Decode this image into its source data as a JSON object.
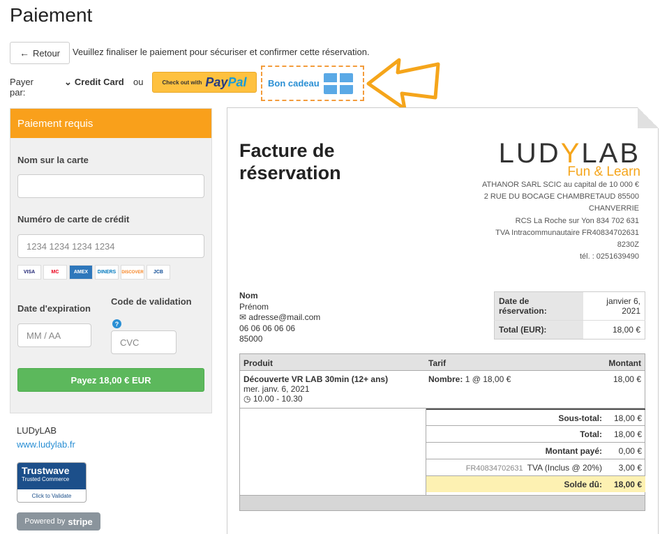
{
  "page": {
    "title": "Paiement",
    "back_label": "Retour",
    "instruction": "Veuillez finaliser le paiement pour sécuriser et confirmer cette réservation."
  },
  "payment_methods": {
    "pay_by_label": "Payer par:",
    "credit_card_label": "Credit Card",
    "or_label": "ou",
    "paypal_small": "Check out with",
    "paypal_brand_a": "Pay",
    "paypal_brand_b": "Pal",
    "gift_label": "Bon cadeau"
  },
  "payment_form": {
    "header": "Paiement requis",
    "name_label": "Nom sur la carte",
    "name_value": "",
    "card_number_label": "Numéro de carte de crédit",
    "card_number_placeholder": "1234 1234 1234 1234",
    "card_brands": [
      "VISA",
      "MC",
      "AMEX",
      "DINERS",
      "DISCOVER",
      "JCB"
    ],
    "expiry_label": "Date d'expiration",
    "expiry_placeholder": "MM / AA",
    "cvc_label": "Code de validation",
    "cvc_placeholder": "CVC",
    "info_icon": "?",
    "submit_label": "Payez 18,00 € EUR"
  },
  "footer": {
    "company": "LUDyLAB",
    "website": "www.ludylab.fr",
    "trustwave_brand": "Trustwave",
    "trustwave_sub": "Trusted Commerce",
    "trustwave_cta": "Click to Validate",
    "stripe_prefix": "Powered by",
    "stripe_brand": "stripe"
  },
  "invoice": {
    "title": "Facture de réservation",
    "logo_text_a": "LUD",
    "logo_text_y": "Y",
    "logo_text_b": "LAB",
    "logo_tagline": "Fun & Learn",
    "company_lines": [
      "ATHANOR SARL SCIC au capital de 10 000 €",
      "2 RUE DU BOCAGE CHAMBRETAUD 85500",
      "CHANVERRIE",
      "RCS La Roche sur Yon 834 702 631",
      "TVA Intracommunautaire FR40834702631",
      "8230Z",
      "tél. : 0251639490"
    ],
    "client": {
      "name": "Nom",
      "firstname": "Prénom",
      "email": "adresse@mail.com",
      "phone": "06 06 06 06 06",
      "postal": "85000"
    },
    "summary": {
      "date_label": "Date de réservation:",
      "date_value": "janvier 6, 2021",
      "total_label": "Total (EUR):",
      "total_value": "18,00 €"
    },
    "table": {
      "headers": [
        "Produit",
        "Tarif",
        "Montant"
      ],
      "item": {
        "name": "Découverte VR LAB 30min (12+ ans)",
        "date": "mer. janv. 6, 2021",
        "time": "10.00 - 10.30",
        "tarif_label": "Nombre:",
        "tarif_value": "1 @ 18,00 €",
        "amount": "18,00 €"
      }
    },
    "totals": {
      "subtotal_label": "Sous-total:",
      "subtotal_value": "18,00 €",
      "total_label": "Total:",
      "total_value": "18,00 €",
      "paid_label": "Montant payé:",
      "paid_value": "0,00 €",
      "vat_number": "FR40834702631",
      "vat_label": "TVA (Inclus @ 20%)",
      "vat_value": "3,00 €",
      "due_label": "Solde dû:",
      "due_value": "18,00 €"
    }
  }
}
